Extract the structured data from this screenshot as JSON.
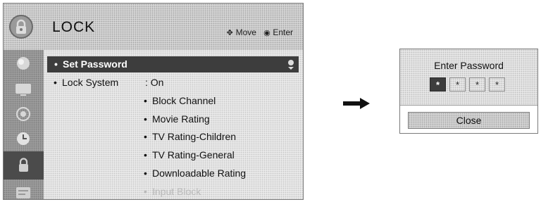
{
  "menu": {
    "title": "LOCK",
    "hint": {
      "move_label": "Move",
      "enter_label": "Enter",
      "move_icon": "move-arrows-icon",
      "enter_icon": "enter-button-icon"
    },
    "sidebar_icons": [
      "picture-icon",
      "screen-icon",
      "audio-icon",
      "clock-icon",
      "lock-icon",
      "option-icon"
    ],
    "active_sidebar_index": 4,
    "items": {
      "set_password": "Set Password",
      "lock_system": {
        "label": "Lock System",
        "value": ": On"
      }
    },
    "sub_items": [
      "Block Channel",
      "Movie Rating",
      "TV Rating-Children",
      "TV Rating-General",
      "Downloadable Rating",
      "Input Block"
    ]
  },
  "password_dialog": {
    "title": "Enter Password",
    "pin_slots": [
      "*",
      "*",
      "*",
      "*"
    ],
    "active_slot_index": 0,
    "close_label": "Close"
  },
  "colors": {
    "highlight": "#3d3d3d",
    "sidebar": "#9d9d9d",
    "panel": "#e9e9e9"
  }
}
